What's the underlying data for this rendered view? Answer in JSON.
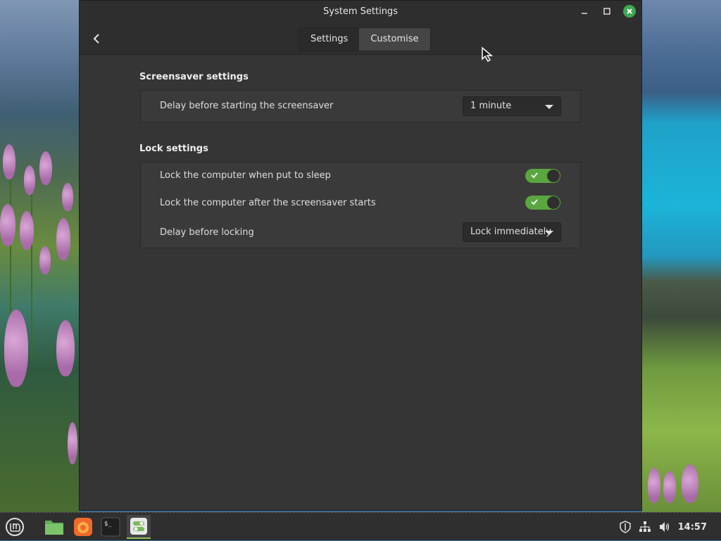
{
  "window": {
    "title": "System Settings",
    "tabs": [
      {
        "label": "Settings",
        "active": false
      },
      {
        "label": "Customise",
        "active": true
      }
    ]
  },
  "screensaver": {
    "section_title": "Screensaver settings",
    "delay_label": "Delay before starting the screensaver",
    "delay_value": "1 minute"
  },
  "lock": {
    "section_title": "Lock settings",
    "sleep_label": "Lock the computer when put to sleep",
    "sleep_on": true,
    "after_label": "Lock the computer after the screensaver starts",
    "after_on": true,
    "delay_label": "Delay before locking",
    "delay_value": "Lock immediately"
  },
  "taskbar": {
    "items": [
      {
        "icon": "mint-menu-icon"
      },
      {
        "icon": "files-icon"
      },
      {
        "icon": "firefox-icon"
      },
      {
        "icon": "terminal-icon"
      },
      {
        "icon": "settings-toggle-icon",
        "active": true
      }
    ],
    "clock": "14:57"
  },
  "colors": {
    "accent": "#5aa63f",
    "window_bg": "#353535",
    "close_button": "#3fa852"
  }
}
